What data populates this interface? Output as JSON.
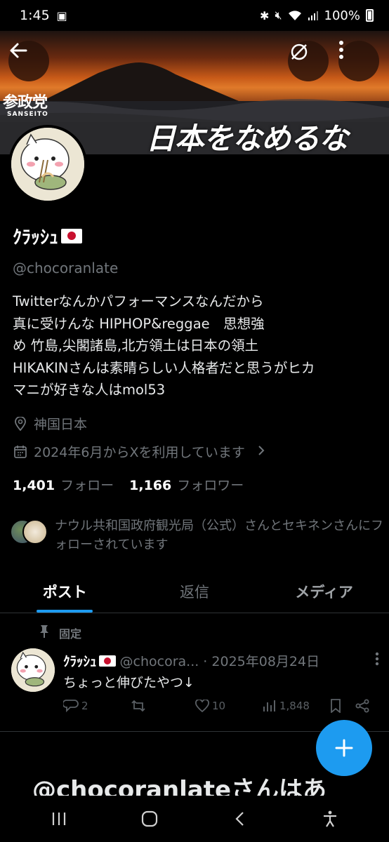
{
  "status_bar": {
    "time": "1:45",
    "battery": "100%"
  },
  "banner": {
    "logo_jp": "参政党",
    "logo_en": "SANSEITO",
    "slogan": "日本をなめるな"
  },
  "profile": {
    "display_name": "ｸﾗｯｼｭ",
    "handle": "@chocoranlate",
    "bio": "Twitterなんかパフォーマンスなんだから\n真に受けんな HIPHOP&reggae　思想強\nめ 竹島,尖閣諸島,北方領土は日本の領土\nHIKAKINさんは素晴らしい人格者だと思うがヒカ\nマニが好きな人はmol53",
    "location": "神国日本",
    "joined": "2024年6月からXを利用しています",
    "following_count": "1,401",
    "following_label": "フォロー",
    "followers_count": "1,166",
    "followers_label": "フォロワー",
    "followed_by": "ナウル共和国政府観光局（公式）さんとセキネンさんにフォローされています"
  },
  "tabs": [
    {
      "label": "ポスト",
      "active": true
    },
    {
      "label": "返信",
      "active": false
    },
    {
      "label": "メディア",
      "active": false
    }
  ],
  "pinned_post": {
    "pinned_label": "固定",
    "name": "ｸﾗｯｼｭ",
    "handle_date": "@chocora... · 2025年08月24日",
    "text": "ちょっと伸びたやつ↓",
    "replies": "2",
    "likes": "10",
    "views": "1,848"
  },
  "teaser_text": "@chocoranlateさんはあ",
  "colors": {
    "accent": "#1d9bf0",
    "background": "#000000",
    "muted": "#71767b"
  },
  "icons": [
    "back-arrow-icon",
    "hide-banner-icon",
    "more-vertical-icon",
    "location-icon",
    "calendar-icon",
    "chevron-right-icon",
    "pin-icon",
    "reply-icon",
    "repost-icon",
    "like-icon",
    "views-icon",
    "bookmark-icon",
    "share-icon",
    "plus-icon"
  ]
}
